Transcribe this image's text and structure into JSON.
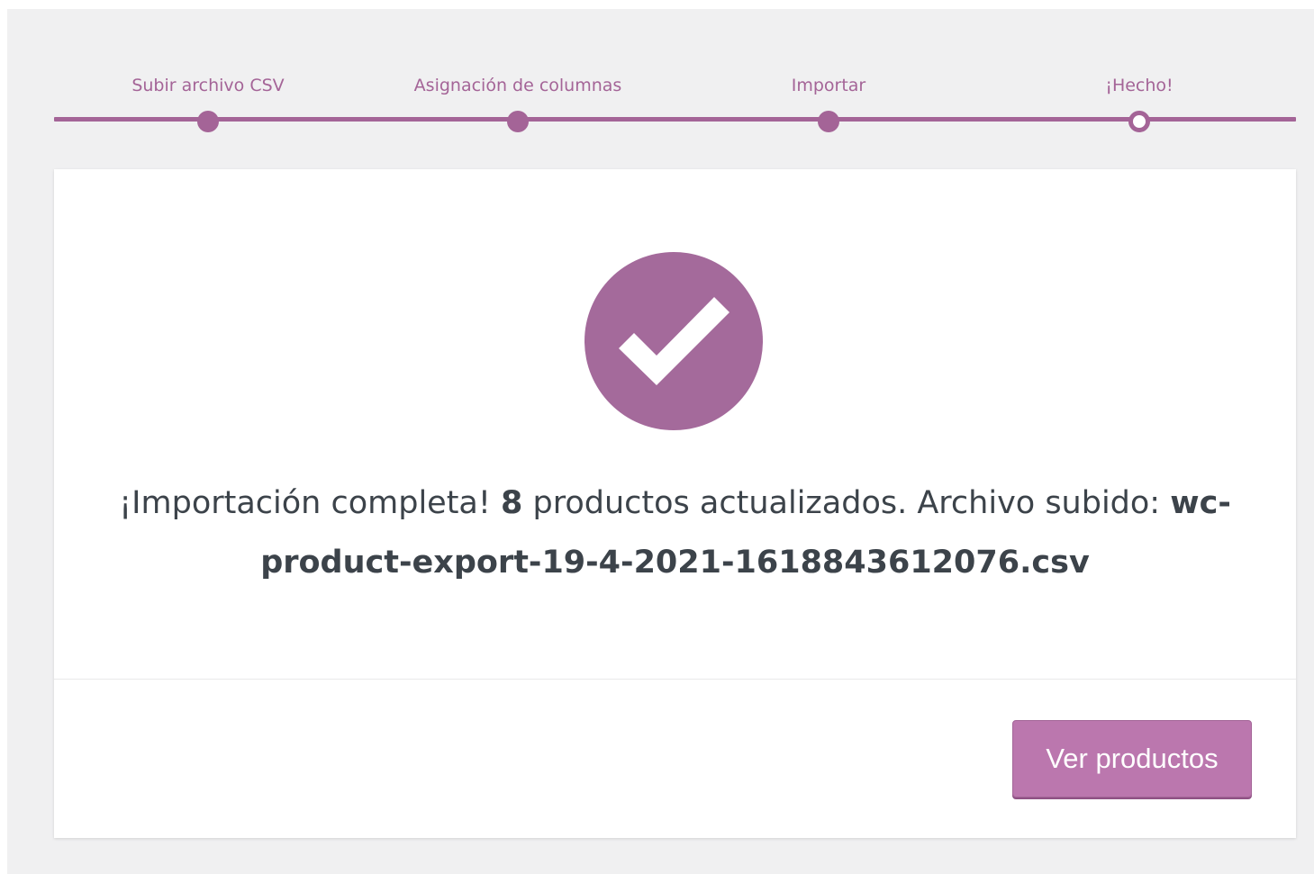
{
  "steps": [
    {
      "label": "Subir archivo CSV",
      "state": "done"
    },
    {
      "label": "Asignación de columnas",
      "state": "done"
    },
    {
      "label": "Importar",
      "state": "done"
    },
    {
      "label": "¡Hecho!",
      "state": "active"
    }
  ],
  "result": {
    "icon": "checkmark-circle-icon",
    "prefix": "¡Importación completa! ",
    "count": "8",
    "middle": " productos actualizados. Archivo subido: ",
    "filename": "wc-product-export-19-4-2021-1618843612076.csv"
  },
  "footer": {
    "view_products_label": "Ver productos"
  },
  "colors": {
    "accent": "#a46497",
    "button_bg": "#bb77ae",
    "page_bg": "#f0f0f1",
    "text": "#3c434a"
  }
}
